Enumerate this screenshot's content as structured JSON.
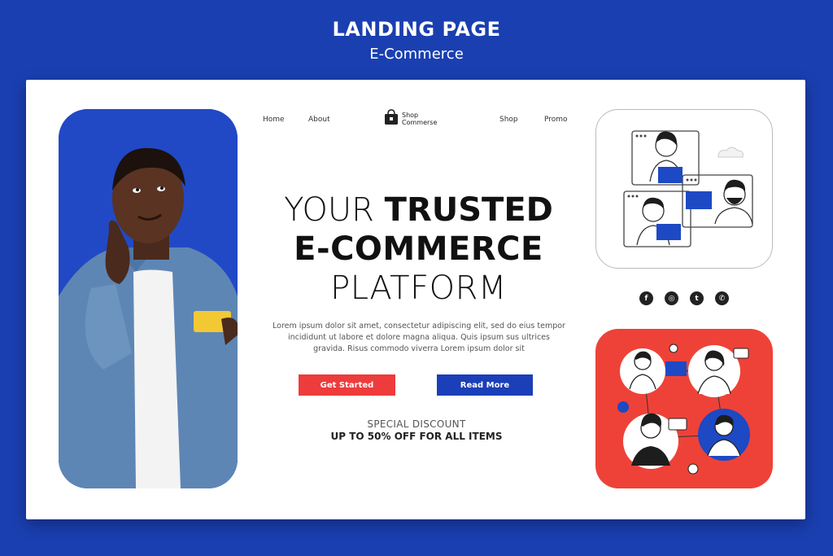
{
  "banner": {
    "title": "LANDING PAGE",
    "subtitle": "E-Commerce"
  },
  "nav": {
    "items": [
      {
        "label": "Home"
      },
      {
        "label": "About"
      },
      {
        "label": "Shop"
      },
      {
        "label": "Promo"
      }
    ],
    "logo_line1": "Shop",
    "logo_line2": "Commerse"
  },
  "hero": {
    "headline_light_1": "YOUR ",
    "headline_bold_1": "TRUSTED",
    "headline_line2": "E-COMMERCE",
    "headline_line3": "PLATFORM",
    "body": "Lorem ipsum dolor sit amet, consectetur adipiscing elit, sed do eius tempor incididunt ut labore et dolore magna aliqua. Quis ipsum sus ultrices gravida. Risus commodo viverra Lorem ipsum dolor sit"
  },
  "actions": {
    "primary_label": "Get Started",
    "secondary_label": "Read More"
  },
  "promo": {
    "line1": "SPECIAL DISCOUNT",
    "line2": "UP TO 50% OFF FOR ALL ITEMS"
  },
  "socials": [
    {
      "icon": "facebook-icon",
      "glyph": "f"
    },
    {
      "icon": "instagram-icon",
      "glyph": "◎"
    },
    {
      "icon": "twitter-icon",
      "glyph": "t"
    },
    {
      "icon": "whatsapp-icon",
      "glyph": "✆"
    }
  ],
  "colors": {
    "background": "#1a3fb0",
    "accent_red": "#ee3b3b",
    "accent_blue": "#1b3fb8"
  }
}
